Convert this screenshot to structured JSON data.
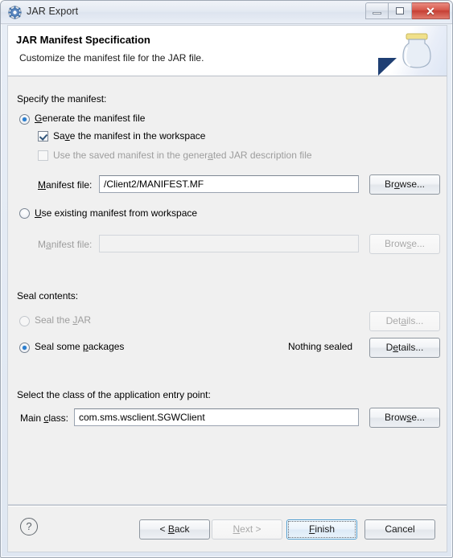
{
  "window": {
    "title": "JAR Export",
    "icon": "jar-export-gear-icon",
    "controls": {
      "minimize": "minimize-icon",
      "maximize": "maximize-icon",
      "close": "close-icon"
    }
  },
  "header": {
    "title": "JAR Manifest Specification",
    "subtitle": "Customize the manifest file for the JAR file.",
    "artwork_icon": "jar-jar-bottle-icon"
  },
  "manifest_section": {
    "legend": "Specify the manifest:",
    "generate_radio": {
      "label": "Generate the manifest file",
      "mnemonic": "G",
      "selected": true
    },
    "save_checkbox": {
      "label": "Save the manifest in the workspace",
      "mnemonic": "v",
      "checked": true,
      "enabled": true
    },
    "use_saved_checkbox": {
      "label": "Use the saved manifest in the generated JAR description file",
      "mnemonic": "a",
      "checked": false,
      "enabled": false
    },
    "manifest_file_label": "Manifest file:",
    "manifest_file_mnemonic": "M",
    "manifest_file_value": "/Client2/MANIFEST.MF",
    "manifest_browse_label": "Browse...",
    "manifest_browse_mnemonic": "o",
    "use_existing_radio": {
      "label": "Use existing manifest from workspace",
      "mnemonic": "U",
      "selected": false
    },
    "existing_file_label": "Manifest file:",
    "existing_file_value": "",
    "existing_browse_label": "Browse...",
    "existing_browse_enabled": false
  },
  "seal_section": {
    "legend": "Seal contents:",
    "seal_jar_radio": {
      "label": "Seal the JAR",
      "mnemonic": "J",
      "selected": false,
      "enabled": false
    },
    "seal_jar_details_label": "Details...",
    "seal_jar_details_enabled": false,
    "seal_packages_radio": {
      "label": "Seal some packages",
      "mnemonic": "p",
      "selected": true,
      "enabled": true
    },
    "sealed_status": "Nothing sealed",
    "seal_packages_details_label": "Details...",
    "seal_packages_details_mnemonic": "e"
  },
  "entry_point_section": {
    "legend": "Select the class of the application entry point:",
    "main_class_label": "Main class:",
    "main_class_mnemonic": "c",
    "main_class_value": "com.sms.wsclient.SGWClient",
    "main_class_browse_label": "Browse...",
    "main_class_browse_mnemonic": "s"
  },
  "footer": {
    "help_icon": "help-question-icon",
    "back_label": "< Back",
    "back_mnemonic": "B",
    "back_enabled": true,
    "next_label": "Next >",
    "next_mnemonic": "N",
    "next_enabled": false,
    "finish_label": "Finish",
    "finish_mnemonic": "F",
    "finish_default": true,
    "cancel_label": "Cancel"
  },
  "colors": {
    "accent": "#2b7fd1",
    "panel": "#f0f0f0",
    "close_button": "#c63f34",
    "default_button_border": "#4f9dd0"
  }
}
